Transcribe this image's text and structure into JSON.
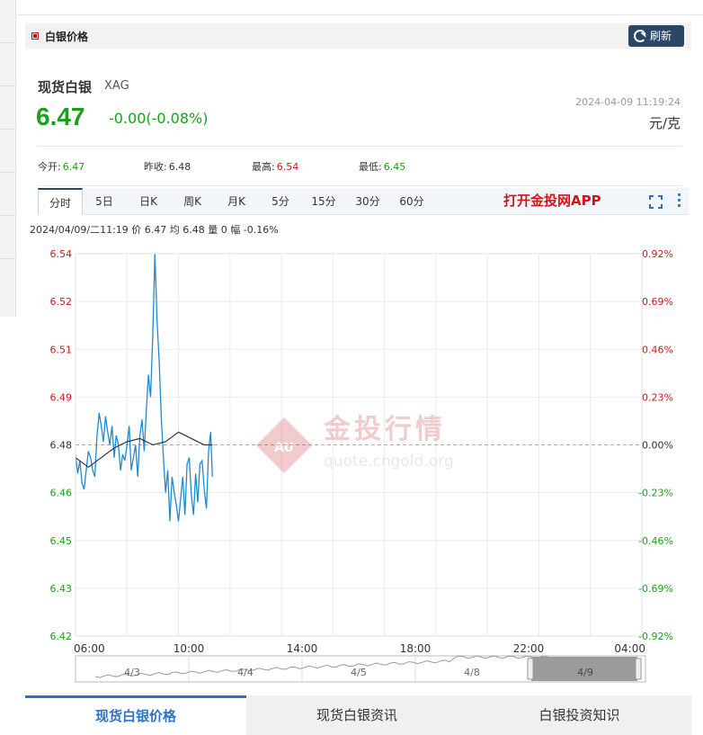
{
  "header": {
    "title": "白银价格",
    "refresh_label": "刷新"
  },
  "quote": {
    "name": "现货白银",
    "code": "XAG",
    "price": "6.47",
    "change": "-0.00(-0.08%)",
    "timestamp": "2024-04-09 11:19:24",
    "unit": "元/克"
  },
  "stats": {
    "open_label": "今开:",
    "open": "6.47",
    "prev_close_label": "昨收:",
    "prev_close": "6.48",
    "high_label": "最高:",
    "high": "6.54",
    "low_label": "最低:",
    "low": "6.45"
  },
  "tabs": [
    "分时",
    "5日",
    "日K",
    "周K",
    "月K",
    "5分",
    "15分",
    "30分",
    "60分"
  ],
  "active_tab": "分时",
  "app_link": "打开金投网APP",
  "info_line": "2024/04/09/二11:19  价 6.47  均 6.48  量 0  幅 -0.16%",
  "watermark": {
    "brand": "金投行情",
    "url": "quote.cngold.org",
    "logo": "AU"
  },
  "bottom_tabs": [
    "现货白银价格",
    "现货白银资讯",
    "白银投资知识"
  ],
  "colors": {
    "up": "#d0161c",
    "down": "#1aa01a",
    "price_line": "#1e8bd0",
    "avg_line": "#333333",
    "accent": "#2b4766"
  },
  "chart_data": {
    "type": "line",
    "y_labels_left": [
      "6.54",
      "6.52",
      "6.51",
      "6.49",
      "6.48",
      "6.46",
      "6.45",
      "6.43",
      "6.42"
    ],
    "y_labels_right": [
      "0.92%",
      "0.69%",
      "0.46%",
      "0.23%",
      "0.00%",
      "-0.23%",
      "-0.46%",
      "-0.69%",
      "-0.92%"
    ],
    "x_labels": [
      "06:00",
      "10:00",
      "14:00",
      "18:00",
      "22:00",
      "04:00"
    ],
    "ylim": [
      6.42,
      6.54
    ],
    "baseline": 6.48,
    "grid": true,
    "series": [
      {
        "name": "价",
        "x": [
          "06:00",
          "06:05",
          "06:10",
          "06:15",
          "06:20",
          "06:25",
          "06:30",
          "06:35",
          "06:40",
          "06:45",
          "06:50",
          "06:55",
          "07:00",
          "07:05",
          "07:10",
          "07:15",
          "07:20",
          "07:25",
          "07:30",
          "07:35",
          "07:40",
          "07:45",
          "07:50",
          "07:55",
          "08:00",
          "08:05",
          "08:10",
          "08:15",
          "08:20",
          "08:25",
          "08:30",
          "08:35",
          "08:40",
          "08:45",
          "08:50",
          "08:55",
          "09:00",
          "09:05",
          "09:10",
          "09:15",
          "09:20",
          "09:25",
          "09:30",
          "09:35",
          "09:40",
          "09:45",
          "09:50",
          "09:55",
          "10:00",
          "10:05",
          "10:10",
          "10:15",
          "10:20",
          "10:25",
          "10:30",
          "10:35",
          "10:40",
          "10:45",
          "10:50",
          "10:55",
          "11:00",
          "11:05",
          "11:10",
          "11:15",
          "11:19"
        ],
        "values": [
          6.477,
          6.471,
          6.475,
          6.468,
          6.466,
          6.472,
          6.478,
          6.476,
          6.472,
          6.47,
          6.483,
          6.49,
          6.486,
          6.481,
          6.489,
          6.484,
          6.48,
          6.486,
          6.476,
          6.483,
          6.48,
          6.472,
          6.477,
          6.475,
          6.48,
          6.486,
          6.472,
          6.476,
          6.48,
          6.47,
          6.483,
          6.488,
          6.478,
          6.491,
          6.502,
          6.495,
          6.514,
          6.54,
          6.519,
          6.506,
          6.488,
          6.476,
          6.465,
          6.472,
          6.456,
          6.47,
          6.465,
          6.461,
          6.456,
          6.463,
          6.47,
          6.458,
          6.474,
          6.476,
          6.464,
          6.458,
          6.471,
          6.462,
          6.474,
          6.475,
          6.466,
          6.46,
          6.478,
          6.484,
          6.47
        ]
      },
      {
        "name": "均",
        "x": [
          "06:00",
          "06:30",
          "07:00",
          "07:30",
          "08:00",
          "08:30",
          "09:00",
          "09:30",
          "10:00",
          "10:30",
          "11:00",
          "11:19"
        ],
        "values": [
          6.476,
          6.473,
          6.476,
          6.479,
          6.481,
          6.482,
          6.48,
          6.481,
          6.484,
          6.482,
          6.48,
          6.48
        ]
      }
    ],
    "navigator": {
      "labels": [
        "4/3",
        "4/4",
        "4/5",
        "4/8",
        "4/9"
      ]
    }
  }
}
